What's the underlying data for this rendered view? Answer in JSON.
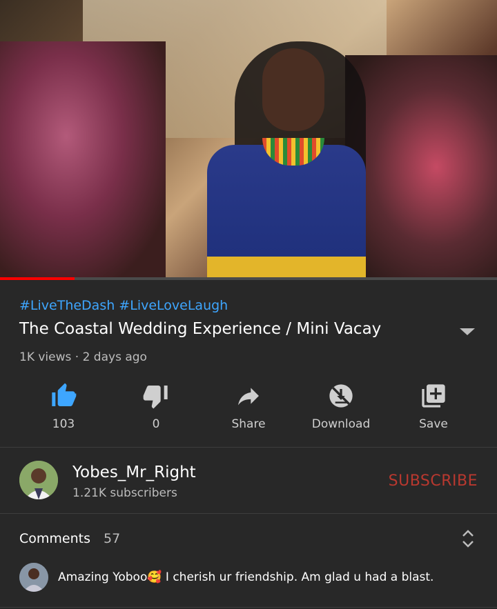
{
  "video": {
    "progress_percent": 15
  },
  "hashtags": "#LiveTheDash #LiveLoveLaugh",
  "title": "The Coastal Wedding Experience / Mini Vacay",
  "meta": "1K views · 2 days ago",
  "actions": [
    {
      "label": "103",
      "icon": "thumbs-up-icon"
    },
    {
      "label": "0",
      "icon": "thumbs-down-icon"
    },
    {
      "label": "Share",
      "icon": "share-icon"
    },
    {
      "label": "Download",
      "icon": "download-icon"
    },
    {
      "label": "Save",
      "icon": "save-to-playlist-icon"
    }
  ],
  "channel": {
    "name": "Yobes_Mr_Right",
    "subscribers": "1.21K subscribers",
    "subscribe_label": "SUBSCRIBE"
  },
  "comments": {
    "title": "Comments",
    "count": "57",
    "top_comment": "Amazing Yoboo🥰 I cherish ur friendship.  Am glad u had a blast."
  },
  "colors": {
    "background": "#282828",
    "hashtag": "#3ea6ff",
    "like_active": "#3ea6ff",
    "subscribe": "#b9382f",
    "progress": "#ff0000"
  }
}
